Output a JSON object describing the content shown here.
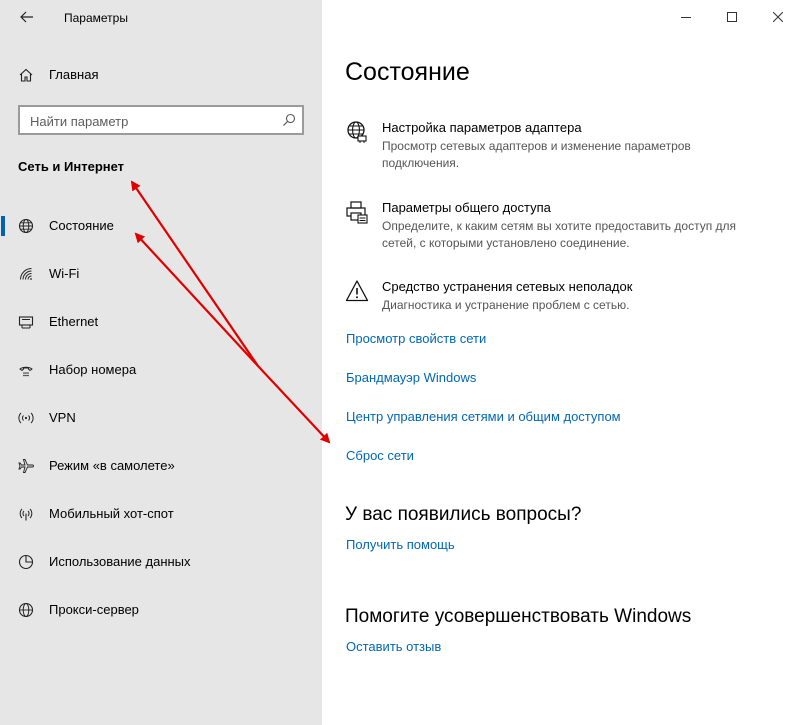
{
  "window": {
    "title": "Параметры",
    "back_icon": "back-arrow-icon",
    "controls": {
      "minimize": "—",
      "maximize": "☐",
      "close": "✕"
    }
  },
  "sidebar": {
    "home_label": "Главная",
    "search_placeholder": "Найти параметр",
    "section_title": "Сеть и Интернет",
    "items": [
      {
        "label": "Состояние",
        "icon": "globe-icon",
        "active": true
      },
      {
        "label": "Wi-Fi",
        "icon": "wifi-icon"
      },
      {
        "label": "Ethernet",
        "icon": "ethernet-icon"
      },
      {
        "label": "Набор номера",
        "icon": "dialup-icon"
      },
      {
        "label": "VPN",
        "icon": "vpn-icon"
      },
      {
        "label": "Режим «в самолете»",
        "icon": "airplane-icon"
      },
      {
        "label": "Мобильный хот-спот",
        "icon": "hotspot-icon"
      },
      {
        "label": "Использование данных",
        "icon": "data-usage-icon"
      },
      {
        "label": "Прокси-сервер",
        "icon": "proxy-globe-icon"
      }
    ]
  },
  "main": {
    "title": "Состояние",
    "settings": [
      {
        "title": "Настройка параметров адаптера",
        "description": "Просмотр сетевых адаптеров и изменение параметров подключения.",
        "icon": "adapter-globe-icon"
      },
      {
        "title": "Параметры общего доступа",
        "description": "Определите, к каким сетям вы хотите предоставить доступ для сетей, с которыми установлено соединение.",
        "icon": "sharing-printer-icon"
      },
      {
        "title": "Средство устранения сетевых неполадок",
        "description": "Диагностика и устранение проблем с сетью.",
        "icon": "warning-icon"
      }
    ],
    "links": [
      "Просмотр свойств сети",
      "Брандмауэр Windows",
      "Центр управления сетями и общим доступом",
      "Сброс сети"
    ],
    "questions_heading": "У вас появились вопросы?",
    "help_link": "Получить помощь",
    "improve_heading": "Помогите усовершенствовать Windows",
    "feedback_link": "Оставить отзыв"
  },
  "colors": {
    "accent": "#0063b1",
    "link": "#0067b8",
    "annotation": "#e00000",
    "sidebar_bg": "#e6e6e6"
  }
}
